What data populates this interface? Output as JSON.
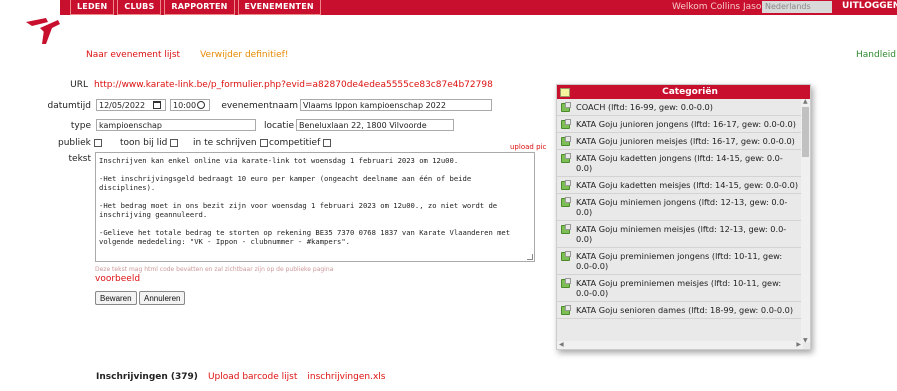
{
  "nav": {
    "items": [
      "LEDEN",
      "CLUBS",
      "RAPPORTEN",
      "EVENEMENTEN"
    ],
    "welcome": "Welkom Collins Jason",
    "lang": "Nederlands",
    "logout": "UITLOGGEN"
  },
  "subnav": {
    "back_link": "Naar evenement lijst",
    "delete_link": "Verwijder definitief!",
    "help": "Handleid"
  },
  "form": {
    "url_label": "URL",
    "url_value": "http://www.karate-link.be/p_formulier.php?evid=a82870de4edea5555ce83c87e4b72798",
    "datetime_label": "datumtijd",
    "date_value": "12/05/2022",
    "time_value": "10:00",
    "name_label": "evenementnaam",
    "name_value": "Vlaams Ippon kampioenschap 2022",
    "type_label": "type",
    "type_value": "kampioenschap",
    "location_label": "locatie",
    "location_value": "Beneluxlaan 22, 1800 Vilvoorde",
    "public_label": "publiek",
    "show_label": "toon bij lid",
    "enroll_label": "in te schrijven",
    "competitive_label": "competitief",
    "upload_pic": "upload pic",
    "text_label": "tekst",
    "text_p1": "Inschrijven kan enkel online via karate-link tot woensdag 1 februari 2023 om 12u00.",
    "text_p2": "-Het inschrijvingsgeld bedraagt 10 euro per kamper (ongeacht deelname aan één of beide disciplines).",
    "text_p3": "-Het bedrag moet in ons bezit zijn voor woensdag 1 februari 2023 om 12u00., zo niet wordt de inschrijving geannuleerd.",
    "text_p4": "-Gelieve het totale bedrag te storten op rekening BE35 7370 0768 1837 van Karate Vlaanderen met volgende mededeling: \"VK - Ippon - clubnummer - #kampers\".",
    "hint": "Deze tekst mag html code bevatten en zal zichtbaar zijn op de publieke pagina",
    "preview": "voorbeeld",
    "save": "Bewaren",
    "cancel": "Annuleren"
  },
  "categories": {
    "title": "Categoriën",
    "items": [
      "COACH (lftd: 16-99, gew: 0.0-0.0)",
      "KATA Goju junioren jongens (lftd: 16-17, gew: 0.0-0.0)",
      "KATA Goju junioren meisjes (lftd: 16-17, gew: 0.0-0.0)",
      "KATA Goju kadetten jongens (lftd: 14-15, gew: 0.0-0.0)",
      "KATA Goju kadetten meisjes (lftd: 14-15, gew: 0.0-0.0)",
      "KATA Goju miniemen jongens (lftd: 12-13, gew: 0.0-0.0)",
      "KATA Goju miniemen meisjes (lftd: 12-13, gew: 0.0-0.0)",
      "KATA Goju preminiemen jongens (lftd: 10-11, gew: 0.0-0.0)",
      "KATA Goju preminiemen meisjes (lftd: 10-11, gew: 0.0-0.0)",
      "KATA Goju senioren dames (lftd: 18-99, gew: 0.0-0.0)"
    ]
  },
  "bottom": {
    "registrations": "Inschrijvingen (379)",
    "upload_barcode": "Upload barcode lijst",
    "xls": "inschrijvingen.xls"
  }
}
